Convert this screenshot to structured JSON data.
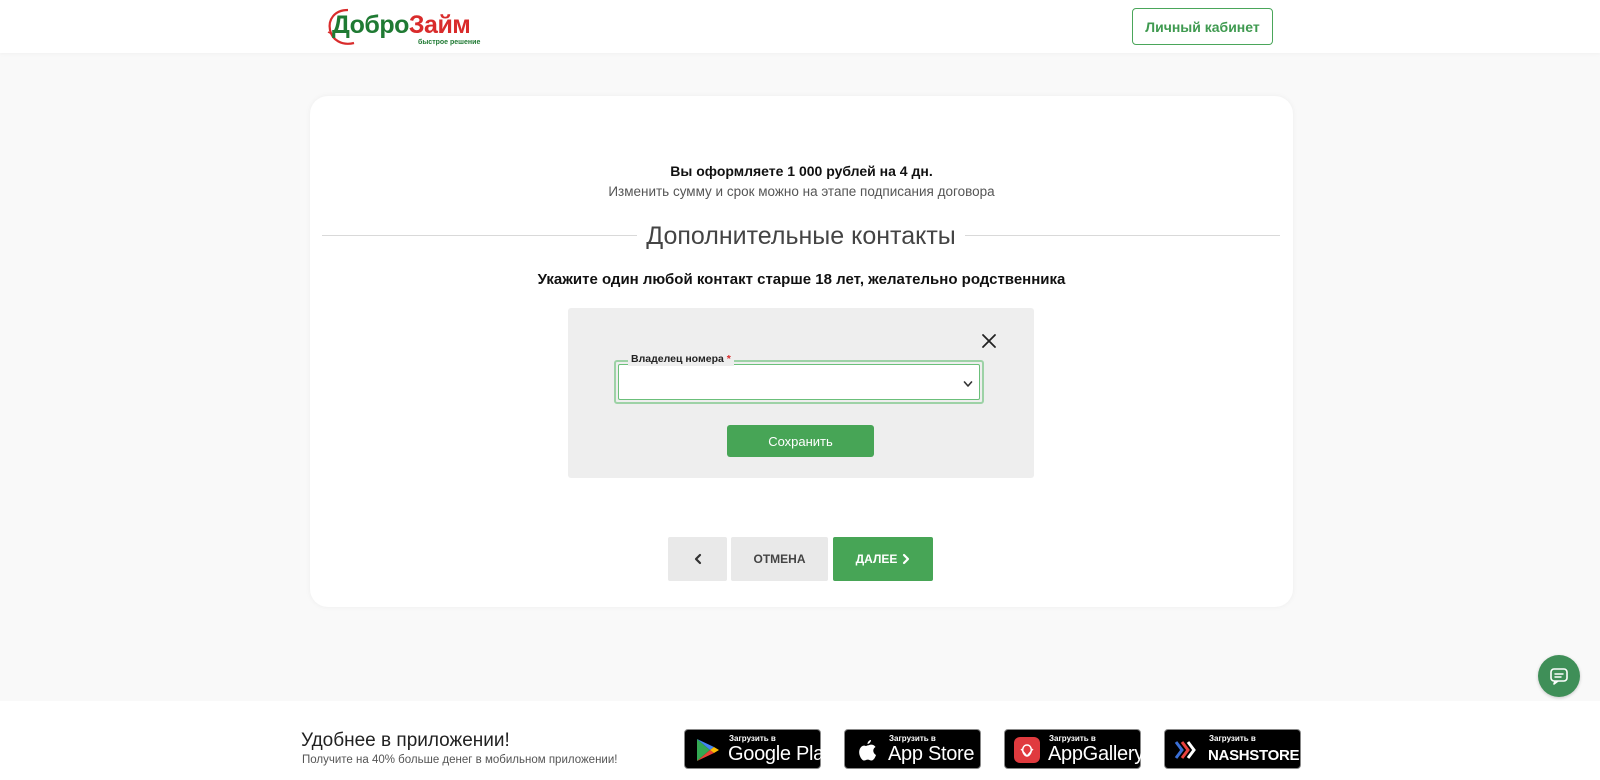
{
  "header": {
    "logo_text_dobro": "Добро",
    "logo_text_zaym": "Займ",
    "logo_tagline": "быстрое решение",
    "cabinet_button": "Личный кабинет"
  },
  "loan": {
    "summary": "Вы оформляете 1 000 рублей на 4 дн.",
    "hint": "Изменить сумму и срок можно на этапе подписания договора"
  },
  "section": {
    "title": "Дополнительные контакты",
    "instruction": "Укажите один любой контакт старше 18 лет, желательно родственника"
  },
  "contact_form": {
    "owner_label": "Владелец номера",
    "required_mark": "*",
    "owner_value": "",
    "save_button": "Сохранить"
  },
  "nav": {
    "cancel": "ОТМЕНА",
    "next": "ДАЛЕЕ"
  },
  "footer": {
    "title": "Удобнее в приложении!",
    "subtitle": "Получите на 40% больше денег в мобильном приложении!",
    "stores": [
      {
        "small": "Загрузить в",
        "big": "Google Play",
        "icon": "google-play-icon"
      },
      {
        "small": "Загрузить в",
        "big": "App Store",
        "icon": "apple-icon"
      },
      {
        "small": "Загрузить в",
        "big": "AppGallery",
        "icon": "huawei-icon"
      },
      {
        "small": "Загрузить в",
        "big": "NASHSTORE",
        "icon": "nashstore-icon"
      }
    ]
  },
  "colors": {
    "brand_green": "#47a556",
    "brand_red": "#d92b2b",
    "chat_green": "#3f8f58"
  }
}
